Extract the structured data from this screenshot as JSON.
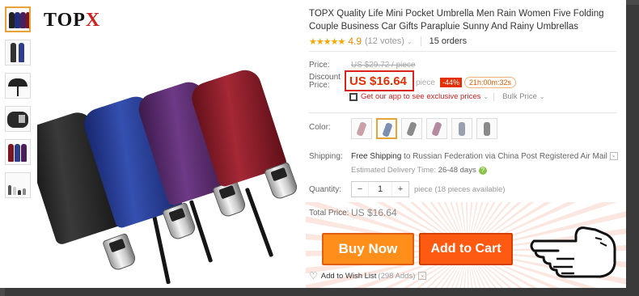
{
  "brand": {
    "name_main": "TOP",
    "name_x": "X"
  },
  "product": {
    "title": "TOPX Quality Life Mini Pocket Umbrella Men Rain Women Five Folding Couple Business Car Gifts Parapluie Sunny And Rainy Umbrellas",
    "stars": "★★★★★",
    "rating": "4.9",
    "votes": "(12 votes)",
    "orders": "15 orders"
  },
  "price": {
    "price_label": "Price:",
    "old_price": "US $29.72 / piece",
    "discount_label_1": "Discount",
    "discount_label_2": "Price:",
    "current": "US $16.64",
    "per_piece": "/ piece",
    "discount_badge": "-44%",
    "timer": "21h:00m:32s",
    "app_link": "Get our app to see exclusive prices",
    "bulk": "Bulk Price"
  },
  "color": {
    "label": "Color:",
    "swatches": [
      "#c9a0a8",
      "#7d8fb0",
      "#8a8a8a",
      "#b38aa0",
      "#9aa0b0",
      "#8a8a8a"
    ],
    "selected_index": 1
  },
  "shipping": {
    "label": "Shipping:",
    "free": "Free Shipping",
    "to": "to Russian Federation via China Post Registered Air Mail",
    "est_label": "Estimated Delivery Time:",
    "est_value": "26-48 days"
  },
  "quantity": {
    "label": "Quantity:",
    "minus": "−",
    "value": "1",
    "plus": "+",
    "available": "piece (18 pieces available)"
  },
  "total": {
    "label": "Total Price:",
    "value": "US $16.64"
  },
  "actions": {
    "buy_now": "Buy Now",
    "add_to_cart": "Add to Cart",
    "wishlist": "Add to Wish List",
    "wishlist_count": "(298 Adds)"
  },
  "umbrellas": [
    {
      "color": "#1e1e1e"
    },
    {
      "color": "#1f2f7a"
    },
    {
      "color": "#4a1f5a"
    },
    {
      "color": "#7a1522"
    }
  ]
}
